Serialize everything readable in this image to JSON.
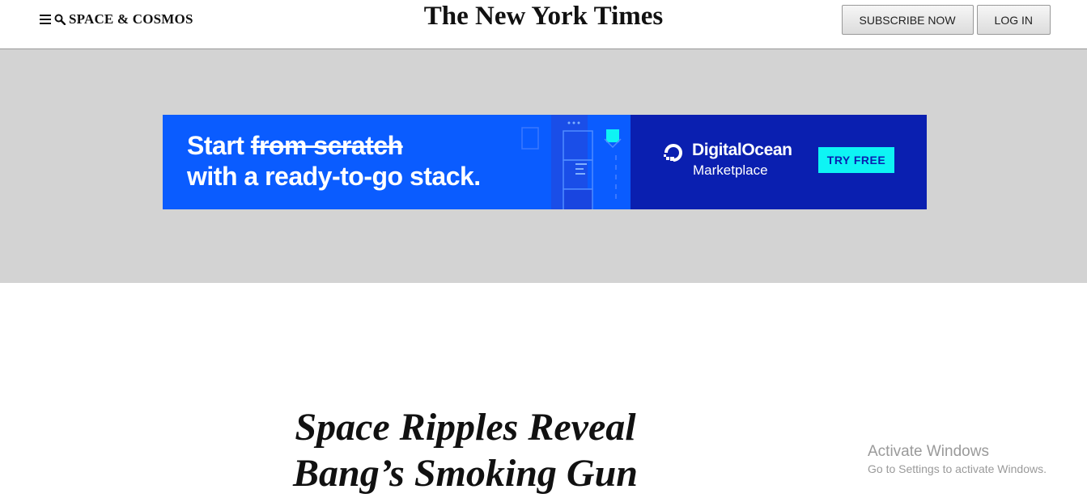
{
  "header": {
    "section": "SPACE & COSMOS",
    "masthead": "The New York Times",
    "subscribe_label": "SUBSCRIBE NOW",
    "login_label": "LOG IN",
    "icons": [
      "menu-icon",
      "search-icon"
    ]
  },
  "ad": {
    "line1_start": "Start",
    "line1_struck": "from scratch",
    "line2": "with a ready-to-go stack.",
    "brand_name": "DigitalOcean",
    "brand_sub": "Marketplace",
    "cta": "TRY FREE",
    "colors": {
      "left_bg": "#0a5cff",
      "right_bg": "#0a1fb0",
      "cta_bg": "#0ef4f4"
    }
  },
  "article": {
    "headline_line1": "Space Ripples Reveal",
    "headline_line2": "Bang’s Smoking Gun"
  },
  "watermark": {
    "title": "Activate Windows",
    "subtitle": "Go to Settings to activate Windows."
  }
}
